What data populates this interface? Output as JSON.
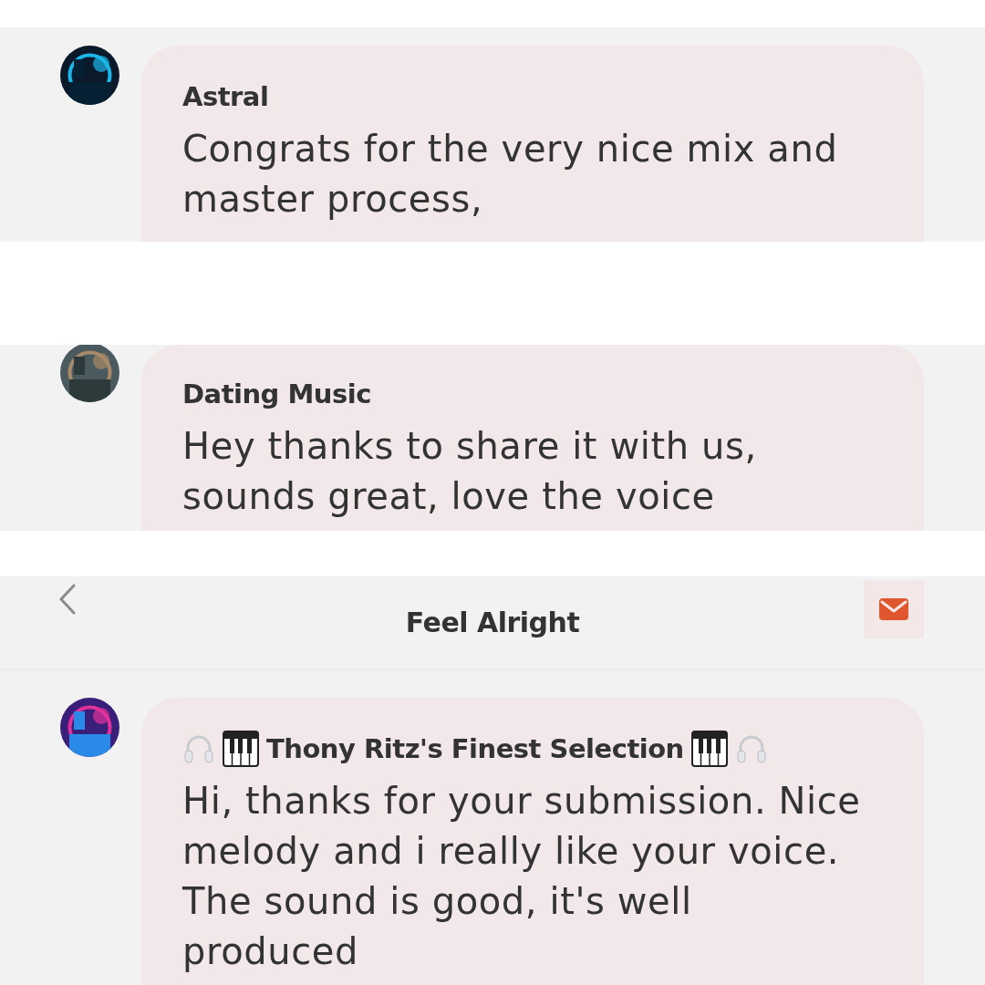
{
  "clips": [
    {
      "kind": "comment",
      "author": "Astral",
      "author_decorated": false,
      "message": "Congrats for the very nice mix and master process,"
    },
    {
      "kind": "comment",
      "author": "Dating Music",
      "author_decorated": false,
      "message": "Hey thanks to share it with us, sounds great, love the voice"
    },
    {
      "kind": "thread",
      "header": {
        "title": "Feel Alright"
      },
      "comment": {
        "author": "Thony Ritz's Finest Selection",
        "author_decorated": true,
        "message": "Hi, thanks for your submission. Nice melody and i really like your voice. The sound is good, it's well produced"
      }
    }
  ]
}
